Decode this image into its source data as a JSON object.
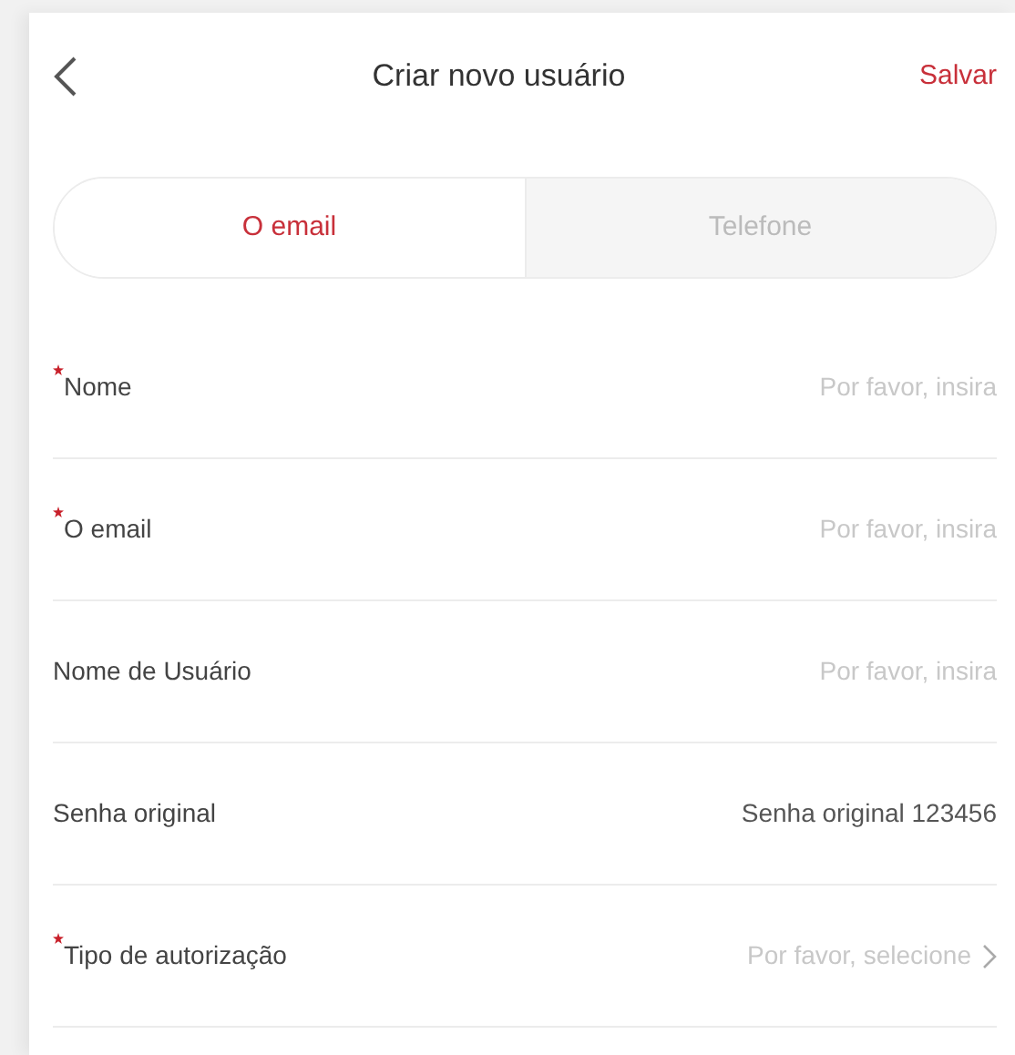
{
  "header": {
    "title": "Criar novo usuário",
    "action": "Salvar"
  },
  "tabs": [
    {
      "label": "O email",
      "selected": true
    },
    {
      "label": "Telefone",
      "selected": false
    }
  ],
  "fields": [
    {
      "label": "Nome",
      "required": true,
      "kind": "input",
      "placeholder": "Por favor, insira"
    },
    {
      "label": "O email",
      "required": true,
      "kind": "input",
      "placeholder": "Por favor, insira"
    },
    {
      "label": "Nome de Usuário",
      "required": false,
      "kind": "input",
      "placeholder": "Por favor, insira"
    },
    {
      "label": "Senha original",
      "required": false,
      "kind": "text",
      "value": "Senha original 123456"
    },
    {
      "label": "Tipo de autorização",
      "required": true,
      "kind": "select",
      "placeholder": "Por favor, selecione"
    }
  ]
}
